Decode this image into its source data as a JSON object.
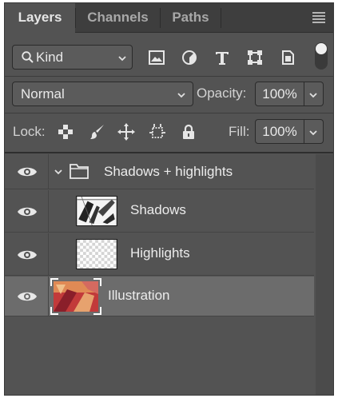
{
  "tabs": [
    {
      "label": "Layers"
    },
    {
      "label": "Channels"
    },
    {
      "label": "Paths"
    }
  ],
  "filter": {
    "kind_label": "Kind",
    "icons": [
      "image-filter-icon",
      "adjustment-filter-icon",
      "type-filter-icon",
      "shape-filter-icon",
      "smart-object-filter-icon"
    ]
  },
  "blend": {
    "mode": "Normal",
    "opacity_label": "Opacity:",
    "opacity_value": "100%"
  },
  "lock": {
    "label": "Lock:",
    "icons": [
      "lock-transparent-pixels-icon",
      "lock-image-pixels-icon",
      "lock-position-icon",
      "lock-artboard-icon",
      "lock-all-icon"
    ],
    "fill_label": "Fill:",
    "fill_value": "100%"
  },
  "layers": [
    {
      "name": "Shadows + highlights",
      "type": "group",
      "expanded": true,
      "visible": true
    },
    {
      "name": "Shadows",
      "type": "pixel",
      "visible": true
    },
    {
      "name": "Highlights",
      "type": "pixel",
      "visible": true
    },
    {
      "name": "Illustration",
      "type": "pixel",
      "visible": true,
      "selected": true
    }
  ],
  "colors": {
    "panel_bg": "#535353",
    "tab_bar_bg": "#3e3e3e",
    "selected_row": "#6c6c6c",
    "text": "#e8e8e8"
  }
}
